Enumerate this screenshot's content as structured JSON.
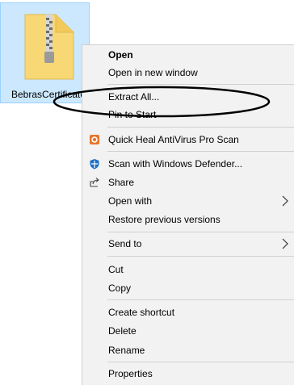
{
  "file": {
    "name": "BebrasCertificate"
  },
  "menu": {
    "open": "Open",
    "open_new_window": "Open in new window",
    "extract_all": "Extract All...",
    "pin_to_start": "Pin to Start",
    "quick_heal": "Quick Heal AntiVirus Pro Scan",
    "scan_defender": "Scan with Windows Defender...",
    "share": "Share",
    "open_with": "Open with",
    "restore_versions": "Restore previous versions",
    "send_to": "Send to",
    "cut": "Cut",
    "copy": "Copy",
    "create_shortcut": "Create shortcut",
    "delete": "Delete",
    "rename": "Rename",
    "properties": "Properties"
  },
  "icons": {
    "file": "zip-folder-icon",
    "quick_heal": "quick-heal-icon",
    "defender": "windows-defender-icon",
    "share": "share-icon",
    "submenu_arrow": "chevron-right-icon"
  },
  "colors": {
    "selection_bg": "#cce8ff",
    "menu_bg": "#f2f2f2",
    "folder": "#f8d775",
    "quick_heal": "#e8742a",
    "defender": "#1e6fc4"
  }
}
